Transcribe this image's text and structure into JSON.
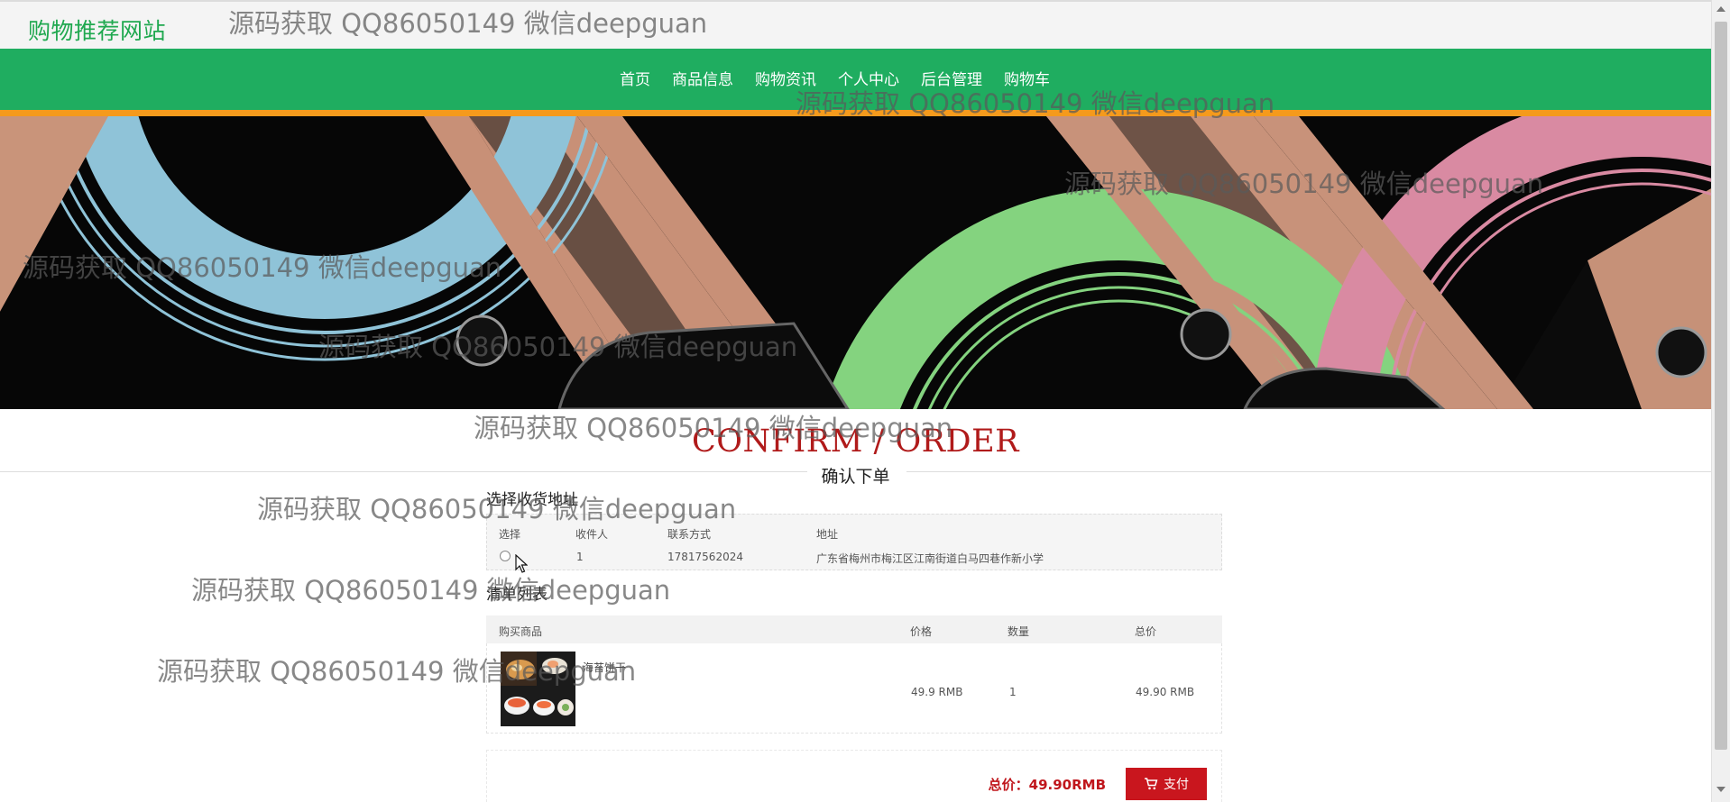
{
  "site": {
    "brand": "购物推荐网站"
  },
  "nav": {
    "items": [
      "首页",
      "商品信息",
      "购物资讯",
      "个人中心",
      "后台管理",
      "购物车"
    ]
  },
  "page": {
    "title_en": "CONFIRM / ORDER",
    "title_cn": "确认下单"
  },
  "address": {
    "section_label": "选择收货地址",
    "headers": [
      "选择",
      "收件人",
      "联系方式",
      "地址"
    ],
    "rows": [
      {
        "recipient": "1",
        "phone": "17817562024",
        "address": "广东省梅州市梅江区江南街道白马四巷作新小学",
        "selected": false
      }
    ]
  },
  "cart": {
    "section_label": "清单列表",
    "headers": [
      "购买商品",
      "价格",
      "数量",
      "总价"
    ],
    "items": [
      {
        "name": "海苔饼干",
        "price": "49.9 RMB",
        "quantity": "1",
        "subtotal": "49.90 RMB"
      }
    ]
  },
  "summary": {
    "total_label": "总价：49.90RMB",
    "pay_label": "支付"
  },
  "watermark": "源码获取 QQ86050149 微信deepguan",
  "colors": {
    "brand": "#1fa84f",
    "nav": "#1fad60",
    "accent_line": "#f59a1c",
    "title_red": "#b01a1a",
    "pay": "#c9161e"
  },
  "icons": {
    "pay": "cart-icon"
  }
}
